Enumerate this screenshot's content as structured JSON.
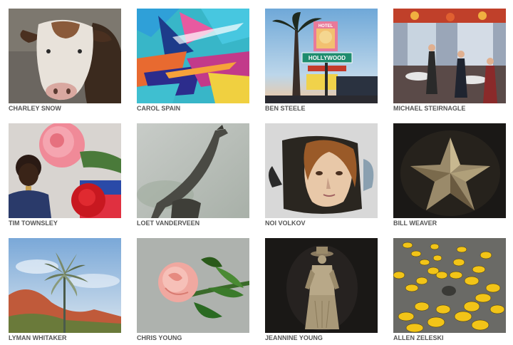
{
  "artists": [
    {
      "name": "CHARLEY SNOW",
      "artwork": "cow-painting"
    },
    {
      "name": "CAROL SPAIN",
      "artwork": "abstract-painting"
    },
    {
      "name": "BEN STEELE",
      "artwork": "hollywood-sign-painting",
      "sign_text": [
        "HOTEL",
        "HOLLYWOOD"
      ]
    },
    {
      "name": "MICHAEL STEIRNAGLE",
      "artwork": "cafe-interior-painting"
    },
    {
      "name": "TIM TOWNSLEY",
      "artwork": "boy-with-roses-painting"
    },
    {
      "name": "LOET VANDERVEEN",
      "artwork": "giraffe-sculpture"
    },
    {
      "name": "NOI VOLKOV",
      "artwork": "teapot-portrait"
    },
    {
      "name": "BILL WEAVER",
      "artwork": "star-sculpture"
    },
    {
      "name": "LYMAN WHITAKER",
      "artwork": "wind-sculpture"
    },
    {
      "name": "CHRIS YOUNG",
      "artwork": "rose-painting"
    },
    {
      "name": "JEANNINE YOUNG",
      "artwork": "cowgirl-sculpture"
    },
    {
      "name": "ALLEN ZELESKI",
      "artwork": "taxi-starburst-photo"
    }
  ]
}
